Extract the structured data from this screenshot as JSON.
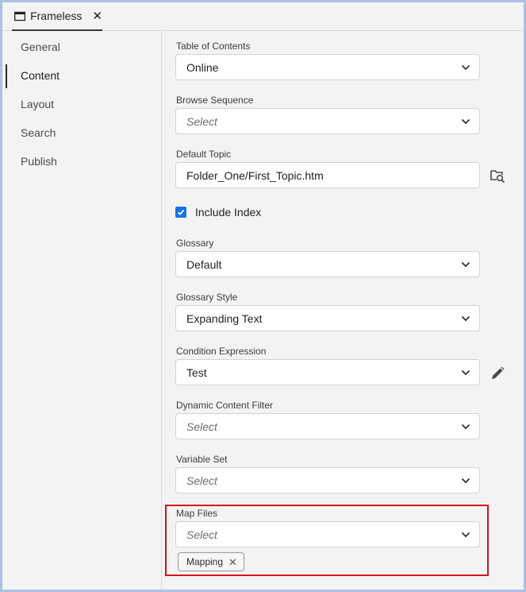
{
  "tab": {
    "label": "Frameless"
  },
  "sidebar": {
    "items": [
      {
        "label": "General",
        "active": false
      },
      {
        "label": "Content",
        "active": true
      },
      {
        "label": "Layout",
        "active": false
      },
      {
        "label": "Search",
        "active": false
      },
      {
        "label": "Publish",
        "active": false
      }
    ]
  },
  "form": {
    "toc": {
      "label": "Table of Contents",
      "value": "Online"
    },
    "browse_sequence": {
      "label": "Browse Sequence",
      "value": "Select"
    },
    "default_topic": {
      "label": "Default Topic",
      "value": "Folder_One/First_Topic.htm"
    },
    "include_index": {
      "label": "Include Index",
      "checked": true
    },
    "glossary": {
      "label": "Glossary",
      "value": "Default"
    },
    "glossary_style": {
      "label": "Glossary Style",
      "value": "Expanding Text"
    },
    "condition_expression": {
      "label": "Condition Expression",
      "value": "Test"
    },
    "dynamic_content_filter": {
      "label": "Dynamic Content Filter",
      "value": "Select"
    },
    "variable_set": {
      "label": "Variable Set",
      "value": "Select"
    },
    "map_files": {
      "label": "Map Files",
      "value": "Select",
      "tags": [
        "Mapping"
      ]
    }
  },
  "colors": {
    "accent": "#1473e6",
    "highlight": "#d0121b",
    "frame_border": "#a9c1e3"
  }
}
